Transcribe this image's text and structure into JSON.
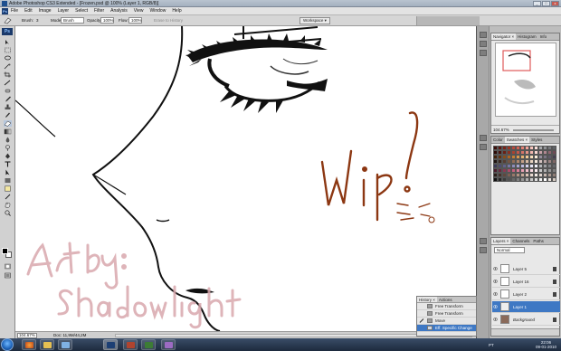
{
  "window": {
    "title": "Adobe Photoshop CS3 Extended - [Frozen.psd @ 100% (Layer 1, RGB/8)]",
    "controls": [
      "_",
      "□",
      "x"
    ]
  },
  "menu": [
    "File",
    "Edit",
    "Image",
    "Layer",
    "Select",
    "Filter",
    "Analysis",
    "View",
    "Window",
    "Help"
  ],
  "options": {
    "brush_label": "Brush:",
    "brush_size": "3",
    "mode_label": "Mode:",
    "mode_value": "Brush",
    "opacity_label": "Opacity:",
    "opacity_value": "100%",
    "flow_label": "Flow:",
    "flow_value": "100%",
    "erase_history": "Erase to History",
    "workspace": "Workspace ▾"
  },
  "canvas": {
    "signature": "Art by : ShadowLight"
  },
  "status": {
    "zoom": "104.67%",
    "doc": "Doc: 11,9M/44,2M"
  },
  "history": {
    "tabs": [
      "History ×",
      "Actions"
    ],
    "items": [
      "Free Transform",
      "Free Transform",
      "Move",
      "Eff. Specific Change"
    ]
  },
  "navigator": {
    "tabs": [
      "Navigator ×",
      "Histogram",
      "Info"
    ],
    "zoom": "104.67%"
  },
  "swatches": {
    "tabs": [
      "Color",
      "Swatches ×",
      "Styles"
    ],
    "colors": [
      "#3b0f0a",
      "#5b1711",
      "#7a2318",
      "#9a3322",
      "#b8473a",
      "#d06052",
      "#e27f73",
      "#f0a39a",
      "#f5c3bb",
      "#fbe0dc",
      "#a6a8ab",
      "#8f9195",
      "#76787c",
      "#5e6064",
      "#2c0a06",
      "#4a140e",
      "#6a2014",
      "#8b2f1f",
      "#a94230",
      "#c2584a",
      "#d57367",
      "#e69488",
      "#f1b6ad",
      "#fad6d1",
      "#c8a2a8",
      "#b08790",
      "#8f6670",
      "#6f4a55",
      "#42220a",
      "#643410",
      "#8a4c18",
      "#ae6421",
      "#c97f34",
      "#dc9a4f",
      "#e8b473",
      "#f2cc98",
      "#f8e0bd",
      "#fcefdc",
      "#948d9b",
      "#7c7484",
      "#615a6a",
      "#474151",
      "#1f1410",
      "#3a2820",
      "#573d30",
      "#755442",
      "#936c55",
      "#ae866c",
      "#c4a086",
      "#d8bba3",
      "#e8d3c0",
      "#f4e8dc",
      "#d3c2c0",
      "#b9a4a3",
      "#9d8584",
      "#7f6766",
      "#3c3a58",
      "#4e4c71",
      "#62618b",
      "#7776a4",
      "#8e8dbb",
      "#a6a5cf",
      "#bebde1",
      "#d4d3ed",
      "#e7e6f6",
      "#f3f3fb",
      "#b5b7ba",
      "#9d9fa3",
      "#828488",
      "#66686c",
      "#4a1b2c",
      "#6a283f",
      "#8b3853",
      "#ac4a68",
      "#c8617f",
      "#db7f98",
      "#e9a0b3",
      "#f3c0cd",
      "#f9dbe3",
      "#fdeef2",
      "#c9c9c9",
      "#b1b1b1",
      "#989898",
      "#7e7e7e",
      "#2a1d18",
      "#45312a",
      "#61473d",
      "#7e5f52",
      "#9a7869",
      "#b49282",
      "#c9ab9c",
      "#dbc3b6",
      "#eadad1",
      "#f5ede8",
      "#e0d4cf",
      "#c8b8b1",
      "#ac9a92",
      "#8f7d75",
      "#101010",
      "#262626",
      "#3b3b3b",
      "#515151",
      "#686868",
      "#7f7f7f",
      "#979797",
      "#afafaf",
      "#c7c7c7",
      "#dfdfdf",
      "#f0f0f0",
      "#ffffff",
      "#e9e2dc",
      "#d2c8bf"
    ]
  },
  "layers": {
    "tabs": [
      "Layers ×",
      "Channels",
      "Paths"
    ],
    "blend": "Normal",
    "items": [
      "Layer 5",
      "Layer 16",
      "Layer 2",
      "Layer 1",
      "Background"
    ]
  },
  "taskbar": {
    "lang": "PT",
    "time": "22:06",
    "date": "09-01-2010"
  },
  "colors": {
    "accent": "#3e78c4",
    "wip_text": "#8c3712",
    "signature": "#d9a8ad"
  }
}
